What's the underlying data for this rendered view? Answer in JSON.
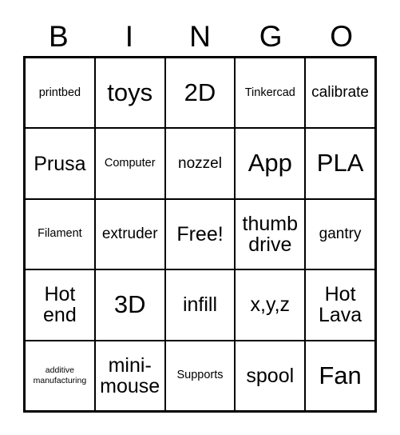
{
  "card": {
    "title": "BINGO",
    "header_letters": [
      "B",
      "I",
      "N",
      "G",
      "O"
    ],
    "rows": [
      [
        {
          "label": "printbed",
          "size": "sm"
        },
        {
          "label": "toys",
          "size": "xl"
        },
        {
          "label": "2D",
          "size": "xl"
        },
        {
          "label": "Tinkercad",
          "size": "sm"
        },
        {
          "label": "calibrate",
          "size": "md"
        }
      ],
      [
        {
          "label": "Prusa",
          "size": "lg"
        },
        {
          "label": "Computer",
          "size": "sm"
        },
        {
          "label": "nozzel",
          "size": "md"
        },
        {
          "label": "App",
          "size": "xl"
        },
        {
          "label": "PLA",
          "size": "xl"
        }
      ],
      [
        {
          "label": "Filament",
          "size": "sm"
        },
        {
          "label": "extruder",
          "size": "md"
        },
        {
          "label": "Free!",
          "size": "lg"
        },
        {
          "label": "thumb\ndrive",
          "size": "lg"
        },
        {
          "label": "gantry",
          "size": "md"
        }
      ],
      [
        {
          "label": "Hot\nend",
          "size": "lg"
        },
        {
          "label": "3D",
          "size": "xl"
        },
        {
          "label": "infill",
          "size": "lg"
        },
        {
          "label": "x,y,z",
          "size": "lg"
        },
        {
          "label": "Hot\nLava",
          "size": "lg"
        }
      ],
      [
        {
          "label": "additive\nmanufacturing",
          "size": "xs"
        },
        {
          "label": "mini-\nmouse",
          "size": "lg"
        },
        {
          "label": "Supports",
          "size": "sm"
        },
        {
          "label": "spool",
          "size": "lg"
        },
        {
          "label": "Fan",
          "size": "xl"
        }
      ]
    ],
    "colors": {
      "ink": "#000000",
      "paper": "#ffffff"
    }
  }
}
